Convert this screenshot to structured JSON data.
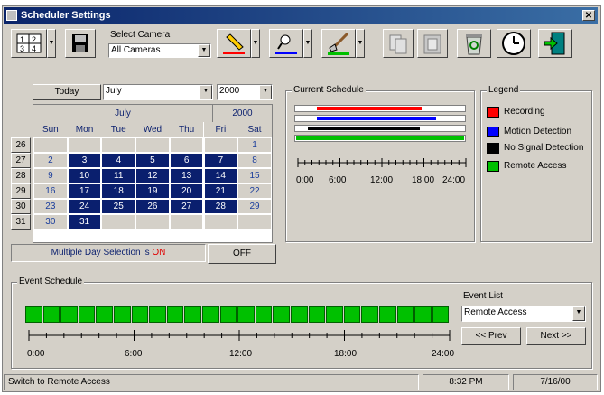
{
  "window": {
    "title": "Scheduler Settings"
  },
  "toolbar": {
    "select_camera_label": "Select Camera",
    "camera_value": "All Cameras"
  },
  "calendar": {
    "today_label": "Today",
    "month_value": "July",
    "year_value": "2000",
    "month_header": "July",
    "year_header": "2000",
    "day_names": [
      "Sun",
      "Mon",
      "Tue",
      "Wed",
      "Thu",
      "Fri",
      "Sat"
    ],
    "week_numbers": [
      "26",
      "27",
      "28",
      "29",
      "30",
      "31"
    ],
    "weeks": [
      [
        "",
        "",
        "",
        "",
        "",
        "",
        "1"
      ],
      [
        "2",
        "3",
        "4",
        "5",
        "6",
        "7",
        "8"
      ],
      [
        "9",
        "10",
        "11",
        "12",
        "13",
        "14",
        "15"
      ],
      [
        "16",
        "17",
        "18",
        "19",
        "20",
        "21",
        "22"
      ],
      [
        "23",
        "24",
        "25",
        "26",
        "27",
        "28",
        "29"
      ],
      [
        "30",
        "31",
        "",
        "",
        "",
        "",
        ""
      ]
    ],
    "multi_day_text": "Multiple Day Selection is",
    "multi_day_state": "ON",
    "off_button": "OFF"
  },
  "current_schedule": {
    "title": "Current Schedule",
    "ticks": [
      "0:00",
      "6:00",
      "12:00",
      "18:00",
      "24:00"
    ]
  },
  "legend": {
    "title": "Legend",
    "items": [
      {
        "label": "Recording",
        "color": "#ff0000"
      },
      {
        "label": "Motion Detection",
        "color": "#0000ff"
      },
      {
        "label": "No Signal Detection",
        "color": "#000000"
      },
      {
        "label": "Remote Access",
        "color": "#00c000"
      }
    ]
  },
  "event_schedule": {
    "title": "Event Schedule",
    "ticks": [
      "0:00",
      "6:00",
      "12:00",
      "18:00",
      "24:00"
    ],
    "event_list_label": "Event List",
    "event_value": "Remote Access",
    "prev_button": "<< Prev",
    "next_button": "Next >>"
  },
  "statusbar": {
    "message": "Switch to Remote Access",
    "time": "8:32 PM",
    "date": "7/16/00"
  }
}
